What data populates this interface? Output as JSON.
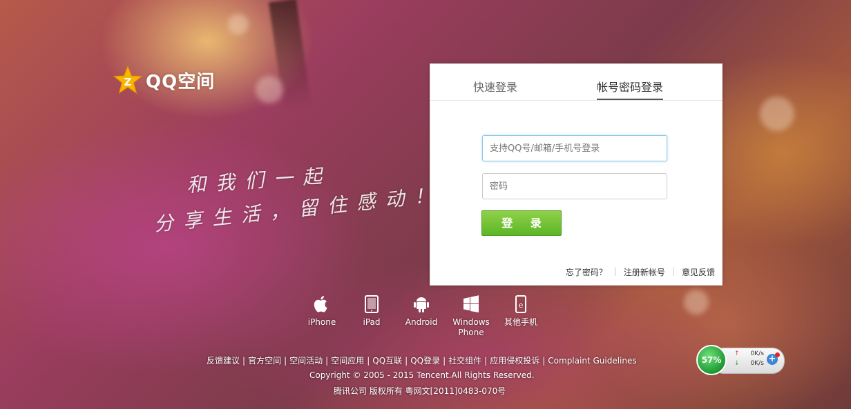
{
  "brand": {
    "logo_text": "QQ空间",
    "logo_icon": "qzone-star-icon"
  },
  "slogan": {
    "line1": "和我们一起",
    "line2": "分享生活，留住感动！"
  },
  "login": {
    "tabs": [
      {
        "label": "快速登录"
      },
      {
        "label": "帐号密码登录",
        "active": true
      }
    ],
    "username_placeholder": "支持QQ号/邮箱/手机号登录",
    "password_placeholder": "密码",
    "submit_label": "登 录",
    "links": {
      "forgot": "忘了密码？",
      "register": "注册新帐号",
      "feedback": "意见反馈"
    }
  },
  "platforms": [
    {
      "label": "iPhone",
      "icon": "apple-icon"
    },
    {
      "label": "iPad",
      "icon": "ipad-icon"
    },
    {
      "label": "Android",
      "icon": "android-icon"
    },
    {
      "label": "Windows Phone",
      "icon": "windows-icon"
    },
    {
      "label": "其他手机",
      "icon": "phone-icon"
    }
  ],
  "footer": {
    "links": [
      "反馈建议",
      "官方空间",
      "空间活动",
      "空间应用",
      "QQ互联",
      "QQ登录",
      "社交组件",
      "应用侵权投诉",
      "Complaint Guidelines"
    ],
    "copyright": "Copyright © 2005 - 2015 Tencent.All Rights Reserved.",
    "license": "腾讯公司 版权所有 粤网文[2011]0483-070号"
  },
  "speed_widget": {
    "percent": "57%",
    "upload": "0K/s",
    "download": "0K/s"
  },
  "colors": {
    "login_button": "#6cc235",
    "panel_bg": "#ffffff",
    "input_focus": "#8fc7e8"
  }
}
